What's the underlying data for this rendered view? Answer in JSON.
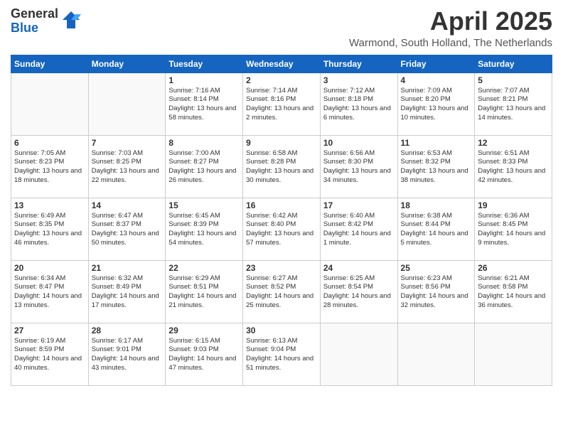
{
  "logo": {
    "general": "General",
    "blue": "Blue"
  },
  "header": {
    "month": "April 2025",
    "location": "Warmond, South Holland, The Netherlands"
  },
  "weekdays": [
    "Sunday",
    "Monday",
    "Tuesday",
    "Wednesday",
    "Thursday",
    "Friday",
    "Saturday"
  ],
  "weeks": [
    [
      {
        "day": "",
        "sunrise": "",
        "sunset": "",
        "daylight": ""
      },
      {
        "day": "",
        "sunrise": "",
        "sunset": "",
        "daylight": ""
      },
      {
        "day": "1",
        "sunrise": "Sunrise: 7:16 AM",
        "sunset": "Sunset: 8:14 PM",
        "daylight": "Daylight: 13 hours and 58 minutes."
      },
      {
        "day": "2",
        "sunrise": "Sunrise: 7:14 AM",
        "sunset": "Sunset: 8:16 PM",
        "daylight": "Daylight: 13 hours and 2 minutes."
      },
      {
        "day": "3",
        "sunrise": "Sunrise: 7:12 AM",
        "sunset": "Sunset: 8:18 PM",
        "daylight": "Daylight: 13 hours and 6 minutes."
      },
      {
        "day": "4",
        "sunrise": "Sunrise: 7:09 AM",
        "sunset": "Sunset: 8:20 PM",
        "daylight": "Daylight: 13 hours and 10 minutes."
      },
      {
        "day": "5",
        "sunrise": "Sunrise: 7:07 AM",
        "sunset": "Sunset: 8:21 PM",
        "daylight": "Daylight: 13 hours and 14 minutes."
      }
    ],
    [
      {
        "day": "6",
        "sunrise": "Sunrise: 7:05 AM",
        "sunset": "Sunset: 8:23 PM",
        "daylight": "Daylight: 13 hours and 18 minutes."
      },
      {
        "day": "7",
        "sunrise": "Sunrise: 7:03 AM",
        "sunset": "Sunset: 8:25 PM",
        "daylight": "Daylight: 13 hours and 22 minutes."
      },
      {
        "day": "8",
        "sunrise": "Sunrise: 7:00 AM",
        "sunset": "Sunset: 8:27 PM",
        "daylight": "Daylight: 13 hours and 26 minutes."
      },
      {
        "day": "9",
        "sunrise": "Sunrise: 6:58 AM",
        "sunset": "Sunset: 8:28 PM",
        "daylight": "Daylight: 13 hours and 30 minutes."
      },
      {
        "day": "10",
        "sunrise": "Sunrise: 6:56 AM",
        "sunset": "Sunset: 8:30 PM",
        "daylight": "Daylight: 13 hours and 34 minutes."
      },
      {
        "day": "11",
        "sunrise": "Sunrise: 6:53 AM",
        "sunset": "Sunset: 8:32 PM",
        "daylight": "Daylight: 13 hours and 38 minutes."
      },
      {
        "day": "12",
        "sunrise": "Sunrise: 6:51 AM",
        "sunset": "Sunset: 8:33 PM",
        "daylight": "Daylight: 13 hours and 42 minutes."
      }
    ],
    [
      {
        "day": "13",
        "sunrise": "Sunrise: 6:49 AM",
        "sunset": "Sunset: 8:35 PM",
        "daylight": "Daylight: 13 hours and 46 minutes."
      },
      {
        "day": "14",
        "sunrise": "Sunrise: 6:47 AM",
        "sunset": "Sunset: 8:37 PM",
        "daylight": "Daylight: 13 hours and 50 minutes."
      },
      {
        "day": "15",
        "sunrise": "Sunrise: 6:45 AM",
        "sunset": "Sunset: 8:39 PM",
        "daylight": "Daylight: 13 hours and 54 minutes."
      },
      {
        "day": "16",
        "sunrise": "Sunrise: 6:42 AM",
        "sunset": "Sunset: 8:40 PM",
        "daylight": "Daylight: 13 hours and 57 minutes."
      },
      {
        "day": "17",
        "sunrise": "Sunrise: 6:40 AM",
        "sunset": "Sunset: 8:42 PM",
        "daylight": "Daylight: 14 hours and 1 minute."
      },
      {
        "day": "18",
        "sunrise": "Sunrise: 6:38 AM",
        "sunset": "Sunset: 8:44 PM",
        "daylight": "Daylight: 14 hours and 5 minutes."
      },
      {
        "day": "19",
        "sunrise": "Sunrise: 6:36 AM",
        "sunset": "Sunset: 8:45 PM",
        "daylight": "Daylight: 14 hours and 9 minutes."
      }
    ],
    [
      {
        "day": "20",
        "sunrise": "Sunrise: 6:34 AM",
        "sunset": "Sunset: 8:47 PM",
        "daylight": "Daylight: 14 hours and 13 minutes."
      },
      {
        "day": "21",
        "sunrise": "Sunrise: 6:32 AM",
        "sunset": "Sunset: 8:49 PM",
        "daylight": "Daylight: 14 hours and 17 minutes."
      },
      {
        "day": "22",
        "sunrise": "Sunrise: 6:29 AM",
        "sunset": "Sunset: 8:51 PM",
        "daylight": "Daylight: 14 hours and 21 minutes."
      },
      {
        "day": "23",
        "sunrise": "Sunrise: 6:27 AM",
        "sunset": "Sunset: 8:52 PM",
        "daylight": "Daylight: 14 hours and 25 minutes."
      },
      {
        "day": "24",
        "sunrise": "Sunrise: 6:25 AM",
        "sunset": "Sunset: 8:54 PM",
        "daylight": "Daylight: 14 hours and 28 minutes."
      },
      {
        "day": "25",
        "sunrise": "Sunrise: 6:23 AM",
        "sunset": "Sunset: 8:56 PM",
        "daylight": "Daylight: 14 hours and 32 minutes."
      },
      {
        "day": "26",
        "sunrise": "Sunrise: 6:21 AM",
        "sunset": "Sunset: 8:58 PM",
        "daylight": "Daylight: 14 hours and 36 minutes."
      }
    ],
    [
      {
        "day": "27",
        "sunrise": "Sunrise: 6:19 AM",
        "sunset": "Sunset: 8:59 PM",
        "daylight": "Daylight: 14 hours and 40 minutes."
      },
      {
        "day": "28",
        "sunrise": "Sunrise: 6:17 AM",
        "sunset": "Sunset: 9:01 PM",
        "daylight": "Daylight: 14 hours and 43 minutes."
      },
      {
        "day": "29",
        "sunrise": "Sunrise: 6:15 AM",
        "sunset": "Sunset: 9:03 PM",
        "daylight": "Daylight: 14 hours and 47 minutes."
      },
      {
        "day": "30",
        "sunrise": "Sunrise: 6:13 AM",
        "sunset": "Sunset: 9:04 PM",
        "daylight": "Daylight: 14 hours and 51 minutes."
      },
      {
        "day": "",
        "sunrise": "",
        "sunset": "",
        "daylight": ""
      },
      {
        "day": "",
        "sunrise": "",
        "sunset": "",
        "daylight": ""
      },
      {
        "day": "",
        "sunrise": "",
        "sunset": "",
        "daylight": ""
      }
    ]
  ]
}
